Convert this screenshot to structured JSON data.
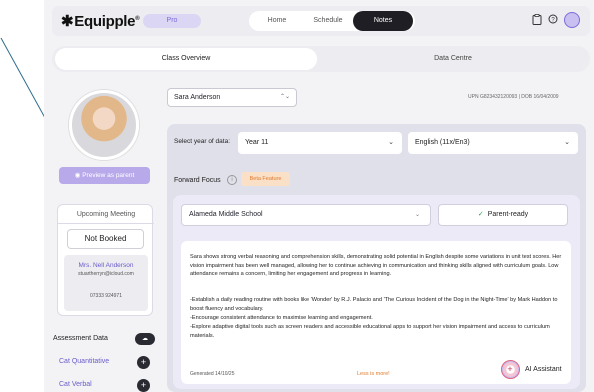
{
  "app": {
    "logo": "Equipple",
    "logo_mark": "®",
    "plan_badge": "Pro"
  },
  "nav": {
    "tabs": [
      "Home",
      "Schedule",
      "Notes"
    ],
    "active_tab": "Notes",
    "icons": [
      "clipboard-icon",
      "help-icon",
      "user-avatar"
    ]
  },
  "subtabs": {
    "items": [
      "Class Overview",
      "Data Centre"
    ],
    "active": "Class Overview"
  },
  "profile": {
    "preview_label": "Preview as parent"
  },
  "meeting": {
    "title": "Upcoming Meeting",
    "status": "Not Booked",
    "teacher_name": "Mrs. Nell Anderson",
    "teacher_email": "stuartherryn@icloud.com",
    "teacher_phone": "07333 924971"
  },
  "assessment": {
    "title": "Assessment Data",
    "items": [
      "Cat Quantitative",
      "Cat Verbal"
    ]
  },
  "student": {
    "selected": "Sara Anderson",
    "meta": "UPN G823432120093 | DOB 16/04/2009"
  },
  "filters": {
    "year_label": "Select year of data:",
    "year_value": "Year 11",
    "subject_value": "English (11x/En3)"
  },
  "forward_focus": {
    "label": "Forward Focus",
    "badge": "Beta Feature",
    "school": "Alameda Middle School",
    "status": "Parent-ready",
    "paragraphs": [
      "Sara shows strong verbal reasoning and comprehension skills, demonstrating solid potential in English despite some variations in unit test scores. Her vision impairment has been well managed, allowing her to continue achieving in communication and thinking skills aligned with curriculum goals. Low attendance remains a concern, limiting her engagement and progress in learning.",
      "-Establish a daily reading routine with books like 'Wonder' by R.J. Palacio and 'The Curious Incident of the Dog in the Night-Time' by Mark Haddon to boost fluency and vocabulary.",
      "-Encourage consistent attendance to maximise learning and engagement.",
      "-Explore adaptive digital tools such as screen readers and accessible educational apps to support her vision impairment and access to curriculum materials."
    ],
    "generated": "Generated 14/10/25",
    "less_more": "Less is more!",
    "ai_label": "AI Assistant"
  },
  "colors": {
    "accent": "#7c6cd6",
    "orange": "#e07b2c",
    "green": "#2a9d56",
    "arrow": "#2e6e8e"
  }
}
